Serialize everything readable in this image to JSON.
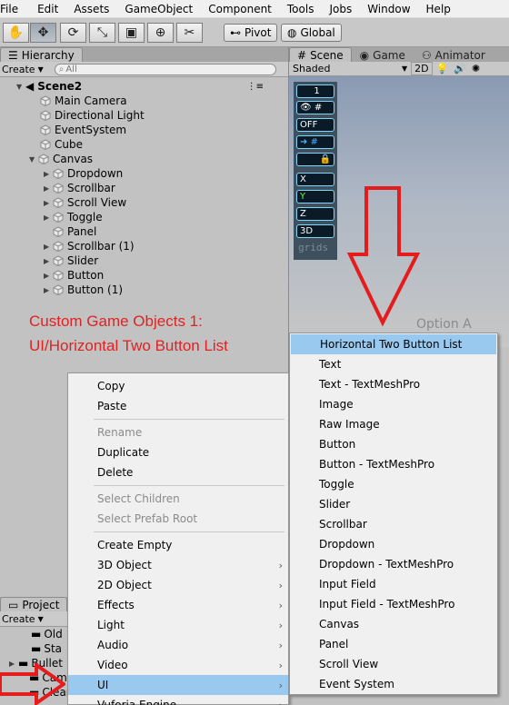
{
  "menubar": [
    "File",
    "Edit",
    "Assets",
    "GameObject",
    "Component",
    "Tools",
    "Jobs",
    "Window",
    "Help"
  ],
  "toolbar": {
    "pivot": "Pivot",
    "global": "Global"
  },
  "hierarchy": {
    "tab": "Hierarchy",
    "create": "Create",
    "search_placeholder": "All",
    "scene_name": "Scene2",
    "items": [
      {
        "label": "Main Camera"
      },
      {
        "label": "Directional Light"
      },
      {
        "label": "EventSystem"
      },
      {
        "label": "Cube"
      },
      {
        "label": "Canvas"
      },
      {
        "label": "Dropdown"
      },
      {
        "label": "Scrollbar"
      },
      {
        "label": "Scroll View"
      },
      {
        "label": "Toggle"
      },
      {
        "label": "Panel"
      },
      {
        "label": "Scrollbar (1)"
      },
      {
        "label": "Slider"
      },
      {
        "label": "Button"
      },
      {
        "label": "Button (1)"
      }
    ]
  },
  "annotation": {
    "line1": "Custom Game Objects 1:",
    "line2": "UI/Horizontal Two Button List"
  },
  "scene": {
    "tabs": [
      "Scene",
      "Game",
      "Animator"
    ],
    "shading": "Shaded",
    "mode_2d": "2D",
    "grid_panel": {
      "value": "1",
      "off": "OFF",
      "axes": [
        "X",
        "Y",
        "Z"
      ],
      "three_d": "3D",
      "caption": "grids"
    },
    "option_text": "Option A"
  },
  "project": {
    "tab": "Project",
    "create": "Create",
    "folders": [
      "Old",
      "Sta",
      "Bullet",
      "Came",
      "Clean"
    ]
  },
  "context_menu": {
    "groups": [
      [
        "Copy",
        "Paste"
      ],
      [
        "Rename",
        "Duplicate",
        "Delete"
      ],
      [
        "Select Children",
        "Select Prefab Root"
      ],
      [
        "Create Empty",
        "3D Object",
        "2D Object",
        "Effects",
        "Light",
        "Audio",
        "Video",
        "UI",
        "Vuforia Engine"
      ]
    ],
    "disabled": [
      "Rename",
      "Select Children",
      "Select Prefab Root"
    ],
    "submenu_items": [
      "3D Object",
      "2D Object",
      "Effects",
      "Light",
      "Audio",
      "Video",
      "UI",
      "Vuforia Engine"
    ],
    "highlighted": "UI"
  },
  "ui_submenu": {
    "items": [
      "Horizontal Two Button List",
      "Text",
      "Text - TextMeshPro",
      "Image",
      "Raw Image",
      "Button",
      "Button - TextMeshPro",
      "Toggle",
      "Slider",
      "Scrollbar",
      "Dropdown",
      "Dropdown - TextMeshPro",
      "Input Field",
      "Input Field - TextMeshPro",
      "Canvas",
      "Panel",
      "Scroll View",
      "Event System"
    ],
    "highlighted": "Horizontal Two Button List"
  },
  "colors": {
    "highlight": "#99c9ef",
    "annotation": "#e02222",
    "grid_accent": "#7fd6ff"
  }
}
